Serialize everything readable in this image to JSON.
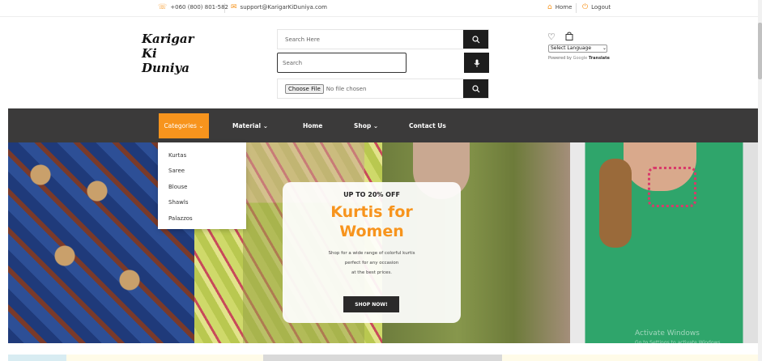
{
  "topbar": {
    "phone": "+060 (800) 801-582",
    "email": "support@KarigarKiDuniya.com",
    "home": "Home",
    "logout": "Logout"
  },
  "logo": {
    "line1": "Karigar",
    "line2": "Ki",
    "line3": "Duniya"
  },
  "search": {
    "text_placeholder": "Search Here",
    "voice_placeholder": "Search",
    "file_button": "Choose File",
    "file_status": "No file chosen"
  },
  "language": {
    "select": "Select Language",
    "powered_by": "Powered by",
    "google": "Google",
    "translate": "Translate"
  },
  "nav": {
    "categories": "Categories",
    "material": "Material",
    "home": "Home",
    "shop": "Shop",
    "contact": "Contact Us"
  },
  "dropdown": {
    "items": [
      "Kurtas",
      "Saree",
      "Blouse",
      "Shawls",
      "Palazzos"
    ]
  },
  "banner": {
    "subtitle": "UP TO 20% OFF",
    "title_line1": "Kurtis for",
    "title_line2": "Women",
    "desc_line1": "Shop for a wide range of colorful kurtis",
    "desc_line2": "perfect for any occasion",
    "desc_line3": "at the best prices.",
    "button": "SHOP NOW!"
  },
  "watermark": {
    "line1": "Activate Windows",
    "line2": "Go to Settings to activate Windows."
  },
  "colors": {
    "accent": "#f7941d",
    "nav_bg": "#3b3a3a",
    "button_dark": "#1d1d1d"
  }
}
